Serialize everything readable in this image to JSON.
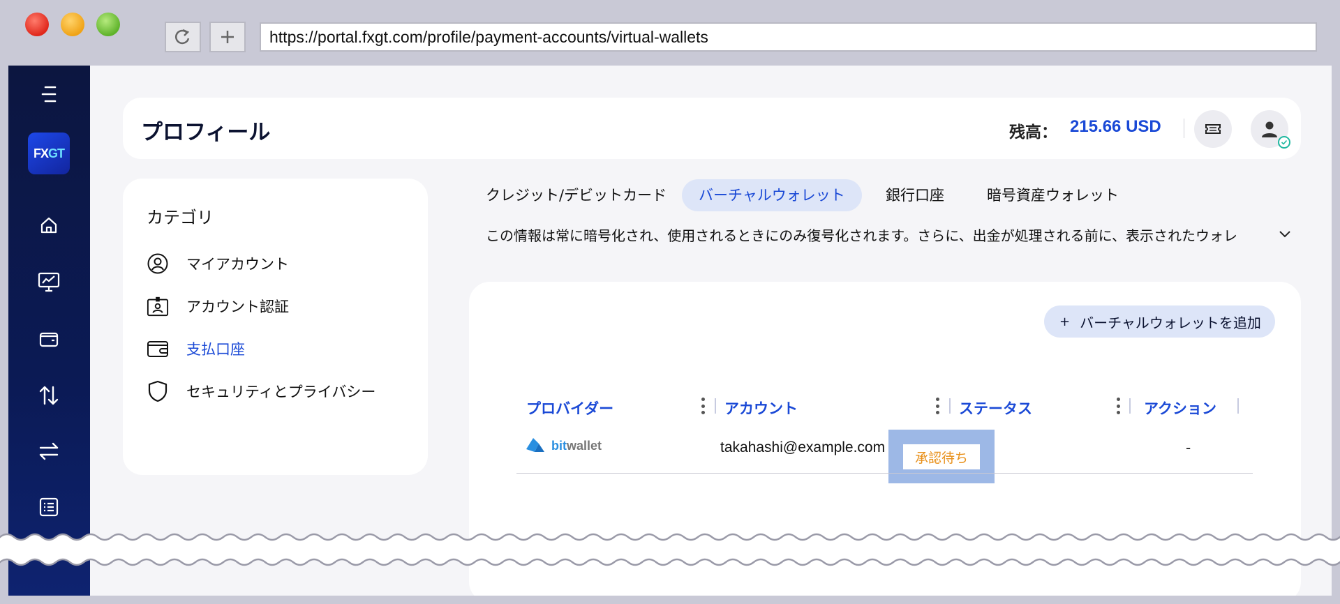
{
  "browser": {
    "url": "https://portal.fxgt.com/profile/payment-accounts/virtual-wallets",
    "reload_icon": "reload-icon",
    "new_tab_icon": "plus-icon"
  },
  "sidebar": {
    "logo_text_fx": "FX",
    "logo_text_gt": "GT",
    "items": [
      {
        "icon": "menu-icon"
      },
      {
        "icon": "home-icon"
      },
      {
        "icon": "chart-monitor-icon"
      },
      {
        "icon": "wallet-icon"
      },
      {
        "icon": "transfer-updown-icon"
      },
      {
        "icon": "exchange-icon"
      },
      {
        "icon": "list-icon"
      }
    ]
  },
  "header": {
    "title": "プロフィール",
    "balance_label": "残高：",
    "balance_value": "215.66 USD"
  },
  "category": {
    "title": "カテゴリ",
    "items": [
      {
        "label": "マイアカウント",
        "icon": "user-circle-icon"
      },
      {
        "label": "アカウント認証",
        "icon": "id-badge-icon"
      },
      {
        "label": "支払口座",
        "icon": "wallet-icon",
        "active": true
      },
      {
        "label": "セキュリティとプライバシー",
        "icon": "shield-icon"
      }
    ]
  },
  "tabs": [
    {
      "label": "クレジット/デビットカード"
    },
    {
      "label": "バーチャルウォレット",
      "active": true
    },
    {
      "label": "銀行口座"
    },
    {
      "label": "暗号資産ウォレット"
    }
  ],
  "info_text": "この情報は常に暗号化され、使用されるときにのみ復号化されます。さらに、出金が処理される前に、表示されたウォレ",
  "main": {
    "add_button": "バーチャルウォレットを追加",
    "add_plus": "+",
    "columns": [
      "プロバイダー",
      "アカウント",
      "ステータス",
      "アクション"
    ],
    "rows": [
      {
        "provider_a": "bit",
        "provider_b": "wallet",
        "account": "takahashi@example.com",
        "status": "承認待ち",
        "action": "-"
      }
    ]
  },
  "colors": {
    "accent": "#1a49d6",
    "sidebar": "#0b1a55",
    "status_pending": "#e8901a",
    "highlight": "#9db8e6"
  }
}
